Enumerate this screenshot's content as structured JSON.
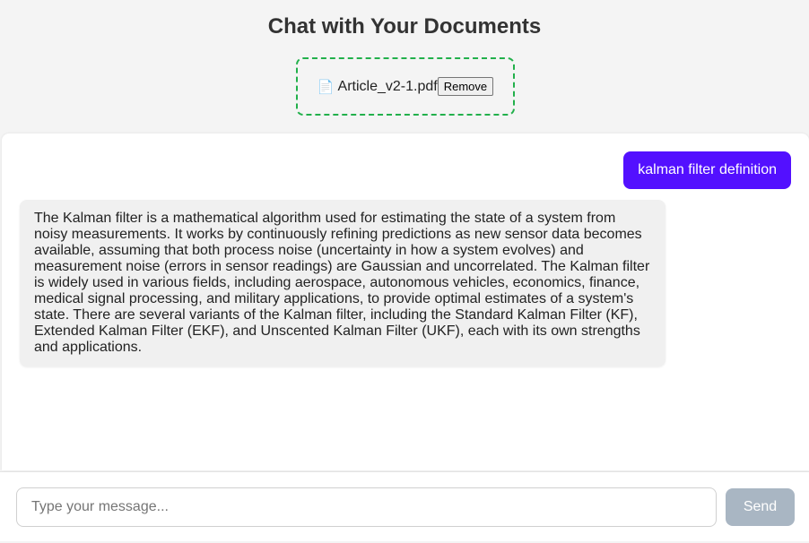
{
  "header": {
    "title": "Chat with Your Documents"
  },
  "upload": {
    "file_icon": "📄",
    "file_icon_name": "document-icon",
    "file_name": "Article_v2-1.pdf",
    "remove_label": "Remove"
  },
  "chat": {
    "messages": [
      {
        "role": "user",
        "text": "kalman filter definition"
      },
      {
        "role": "assistant",
        "text": "The Kalman filter is a mathematical algorithm used for estimating the state of a system from noisy measurements. It works by continuously refining predictions as new sensor data becomes available, assuming that both process noise (uncertainty in how a system evolves) and measurement noise (errors in sensor readings) are Gaussian and uncorrelated. The Kalman filter is widely used in various fields, including aerospace, autonomous vehicles, economics, finance, medical signal processing, and military applications, to provide optimal estimates of a system's state. There are several variants of the Kalman filter, including the Standard Kalman Filter (KF), Extended Kalman Filter (EKF), and Unscented Kalman Filter (UKF), each with its own strengths and applications."
      }
    ]
  },
  "composer": {
    "value": "",
    "placeholder": "Type your message...",
    "send_label": "Send"
  },
  "colors": {
    "accent": "#5310ff",
    "dashed_border": "#22b04b",
    "send_disabled": "#a9b6c3",
    "bot_bubble": "#f0f0f0"
  }
}
